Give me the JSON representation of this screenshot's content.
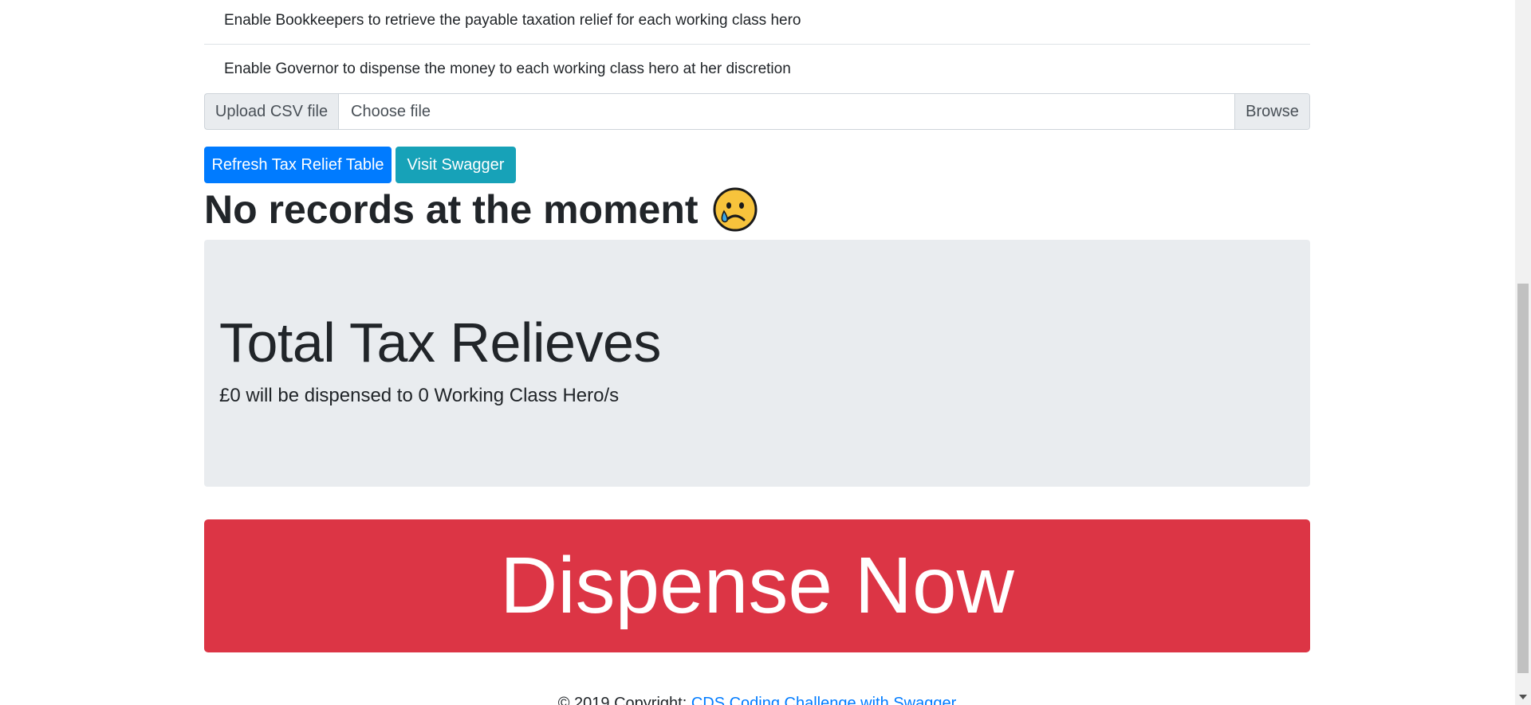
{
  "features": {
    "items": [
      "Enable Bookkeepers to retrieve the payable taxation relief for each working class hero",
      "Enable Governor to dispense the money to each working class hero at her discretion"
    ]
  },
  "upload": {
    "label": "Upload CSV file",
    "placeholder": "Choose file",
    "browse_label": "Browse"
  },
  "buttons": {
    "refresh_label": "Refresh Tax Relief Table",
    "swagger_label": "Visit Swagger"
  },
  "status": {
    "heading": "No records at the moment",
    "emoji_icon": "crying-face-icon"
  },
  "summary": {
    "title": "Total Tax Relieves",
    "lead": "£0 will be dispensed to 0 Working Class Hero/s"
  },
  "dispense": {
    "label": "Dispense Now"
  },
  "footer": {
    "copyright_text": "© 2019 Copyright: ",
    "link_text": "CDS Coding Challenge with Swagger"
  },
  "colors": {
    "primary": "#007bff",
    "info": "#17a2b8",
    "danger": "#dc3545",
    "jumbotron_bg": "#e9ecef"
  }
}
